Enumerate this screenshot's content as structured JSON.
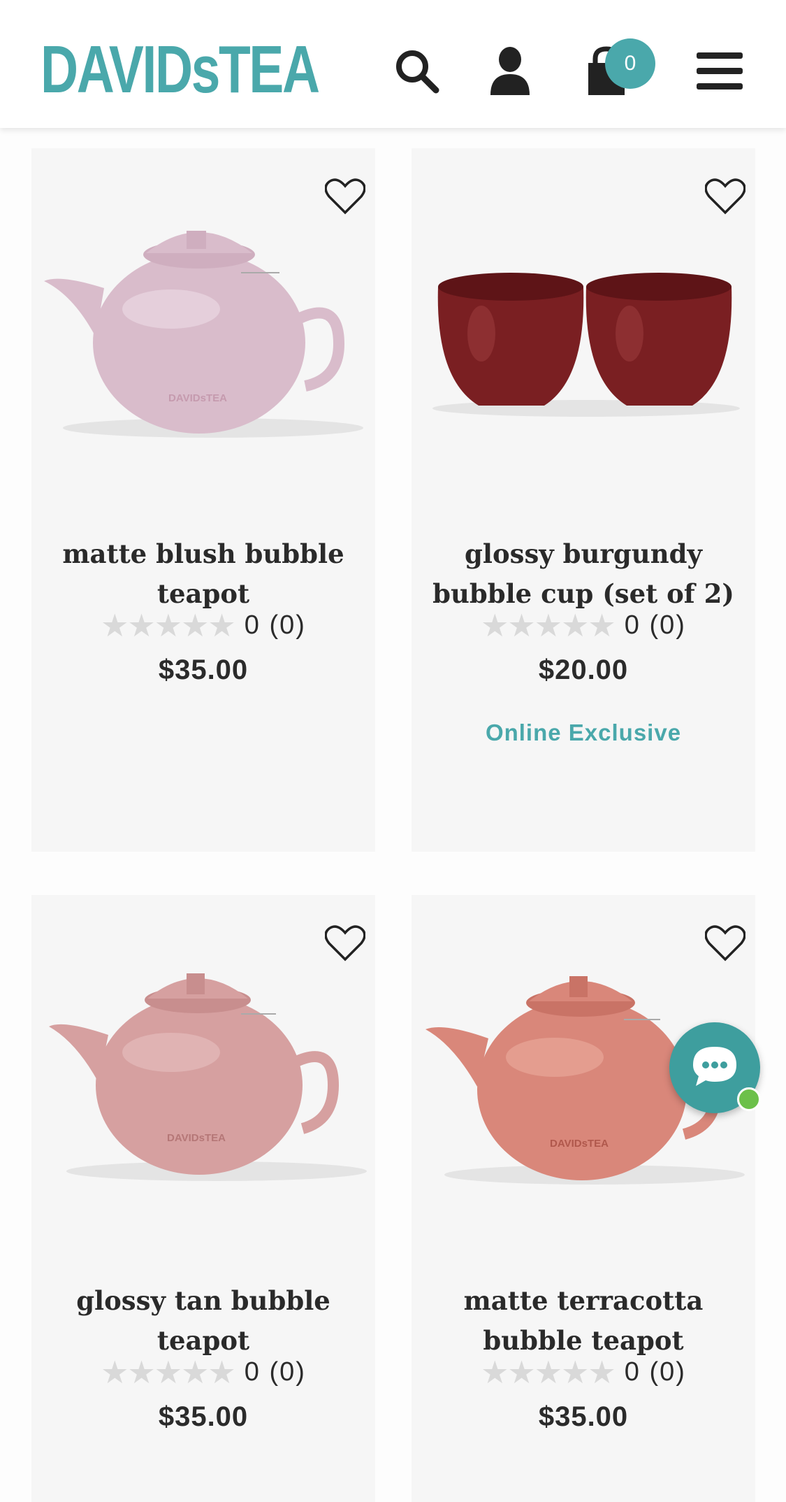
{
  "header": {
    "logo_main": "DAVIDs",
    "logo_small": "",
    "logo_tea": "TEA",
    "cart_count": "0",
    "icons": [
      "search-icon",
      "account-icon",
      "cart-icon",
      "menu-icon"
    ]
  },
  "colors": {
    "brand": "#4aa8ab",
    "card_bg": "#f6f6f6",
    "star_empty": "#d9d9d9",
    "chat_online": "#6cc04a"
  },
  "products": [
    {
      "title": "matte blush bubble teapot",
      "stars": "★★★★★",
      "rating": "0 (0)",
      "price": "$35.00",
      "badge": "",
      "image": "teapot",
      "image_color": "#d9bccb"
    },
    {
      "title": "glossy burgundy bubble cup (set of 2)",
      "stars": "★★★★★",
      "rating": "0 (0)",
      "price": "$20.00",
      "badge": "Online Exclusive",
      "image": "cups",
      "image_color": "#7a1f22"
    },
    {
      "title": "glossy tan bubble teapot",
      "stars": "★★★★★",
      "rating": "0 (0)",
      "price": "$35.00",
      "badge": "",
      "image": "teapot",
      "image_color": "#d6a0a0"
    },
    {
      "title": "matte terracotta bubble teapot",
      "stars": "★★★★★",
      "rating": "0 (0)",
      "price": "$35.00",
      "badge": "",
      "image": "teapot",
      "image_color": "#d9877a"
    }
  ],
  "product_image_label": "DAVIDsTEA",
  "chat": {
    "icon": "chat-icon",
    "status": "online"
  }
}
